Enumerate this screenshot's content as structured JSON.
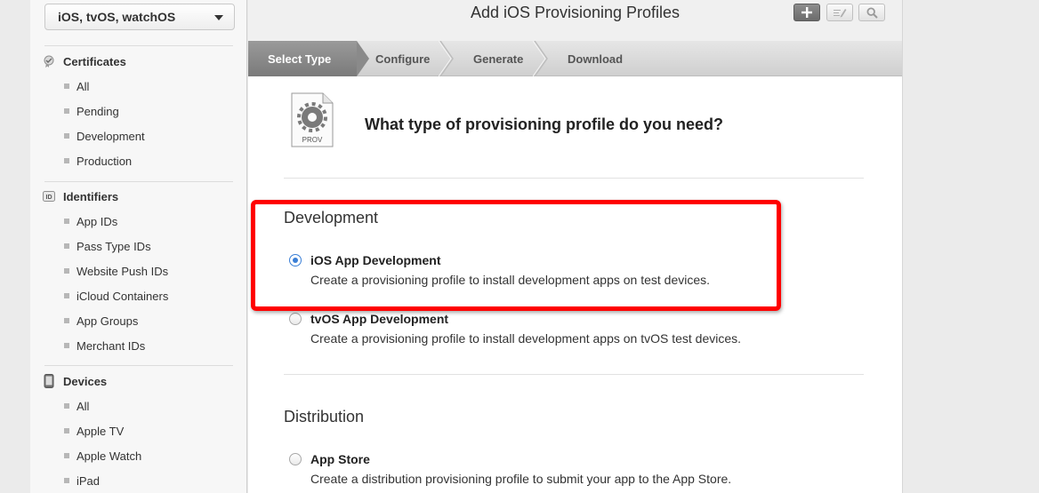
{
  "sidebar": {
    "platform": "iOS, tvOS, watchOS",
    "certificates": {
      "heading": "Certificates",
      "items": [
        "All",
        "Pending",
        "Development",
        "Production"
      ]
    },
    "identifiers": {
      "heading": "Identifiers",
      "icon_text": "ID",
      "items": [
        "App IDs",
        "Pass Type IDs",
        "Website Push IDs",
        "iCloud Containers",
        "App Groups",
        "Merchant IDs"
      ]
    },
    "devices": {
      "heading": "Devices",
      "items": [
        "All",
        "Apple TV",
        "Apple Watch",
        "iPad"
      ]
    }
  },
  "header": {
    "title": "Add iOS Provisioning Profiles"
  },
  "steps": [
    "Select Type",
    "Configure",
    "Generate",
    "Download"
  ],
  "content": {
    "icon_label": "PROV",
    "question": "What type of provisioning profile do you need?",
    "development": {
      "heading": "Development",
      "options": [
        {
          "title": "iOS App Development",
          "desc": "Create a provisioning profile to install development apps on test devices.",
          "selected": true
        },
        {
          "title": "tvOS App Development",
          "desc": "Create a provisioning profile to install development apps on tvOS test devices.",
          "selected": false
        }
      ]
    },
    "distribution": {
      "heading": "Distribution",
      "options": [
        {
          "title": "App Store",
          "desc": "Create a distribution provisioning profile to submit your app to the App Store.",
          "selected": false
        }
      ]
    }
  },
  "colors": {
    "highlight": "#ff0000",
    "radio_selected": "#3a7fd6",
    "step_active": "#8a8a8a"
  }
}
